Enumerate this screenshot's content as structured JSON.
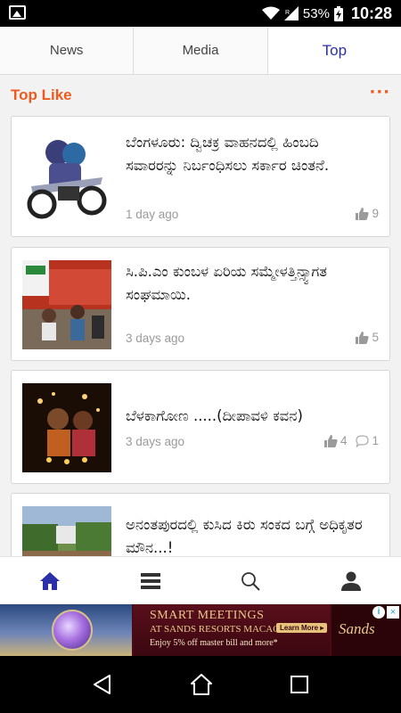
{
  "status_bar": {
    "battery_percent": "53%",
    "time": "10:28"
  },
  "tabs": [
    {
      "label": "News",
      "active": false
    },
    {
      "label": "Media",
      "active": false
    },
    {
      "label": "Top",
      "active": true
    }
  ],
  "section": {
    "title": "Top Like",
    "more_icon": "more-dots-icon"
  },
  "articles": [
    {
      "title": "ಬೆಂಗಳೂರು:  ದ್ವಿಚಕ್ರ ವಾಹನದಲ್ಲಿ ಹಿಂಬದಿ ಸವಾರರನ್ನು ನಿರ್ಬಂಧಿಸಲು ಸರ್ಕಾರ ಚಿಂತನೆ.",
      "time": "1 day ago",
      "likes": "9",
      "comments": ""
    },
    {
      "title": "ಸಿ.ಪಿ.ಎಂ ಕುಂಬಳ ಏರಿಯ ಸಮ್ಮೇಳತ್ತಿನ್ಸ್ವಾಗತ ಸಂಘಮಾಯಿ.",
      "time": "3 days ago",
      "likes": "5",
      "comments": ""
    },
    {
      "title": "ಬೆಳಕಾಗೋಣ .....(ದೀಪಾವಳಿ ಕವನ)",
      "time": "3 days ago",
      "likes": "4",
      "comments": "1"
    },
    {
      "title": "ಅನಂತಪುರದಲ್ಲಿ ಕುಸಿದ ಕಿರು ಸಂಕದ ಬಗ್ಗೆ ಅಧಿಕೃತರ ಮೌನ...!",
      "time": "",
      "likes": "",
      "comments": ""
    }
  ],
  "bottom_nav": [
    {
      "icon": "home-icon",
      "active": true
    },
    {
      "icon": "list-icon",
      "active": false
    },
    {
      "icon": "search-icon",
      "active": false
    },
    {
      "icon": "profile-icon",
      "active": false
    }
  ],
  "ad": {
    "headline": "SMART MEETINGS",
    "subline": "AT SANDS RESORTS MACAO",
    "offer": "Enjoy 5% off master bill and more*",
    "cta": "Learn More ▸",
    "brand": "Sands",
    "info": "i",
    "close": "×"
  },
  "colors": {
    "accent": "#ee5a1e",
    "active_tab": "#2b2fa8",
    "active_nav": "#2b2fa8"
  }
}
